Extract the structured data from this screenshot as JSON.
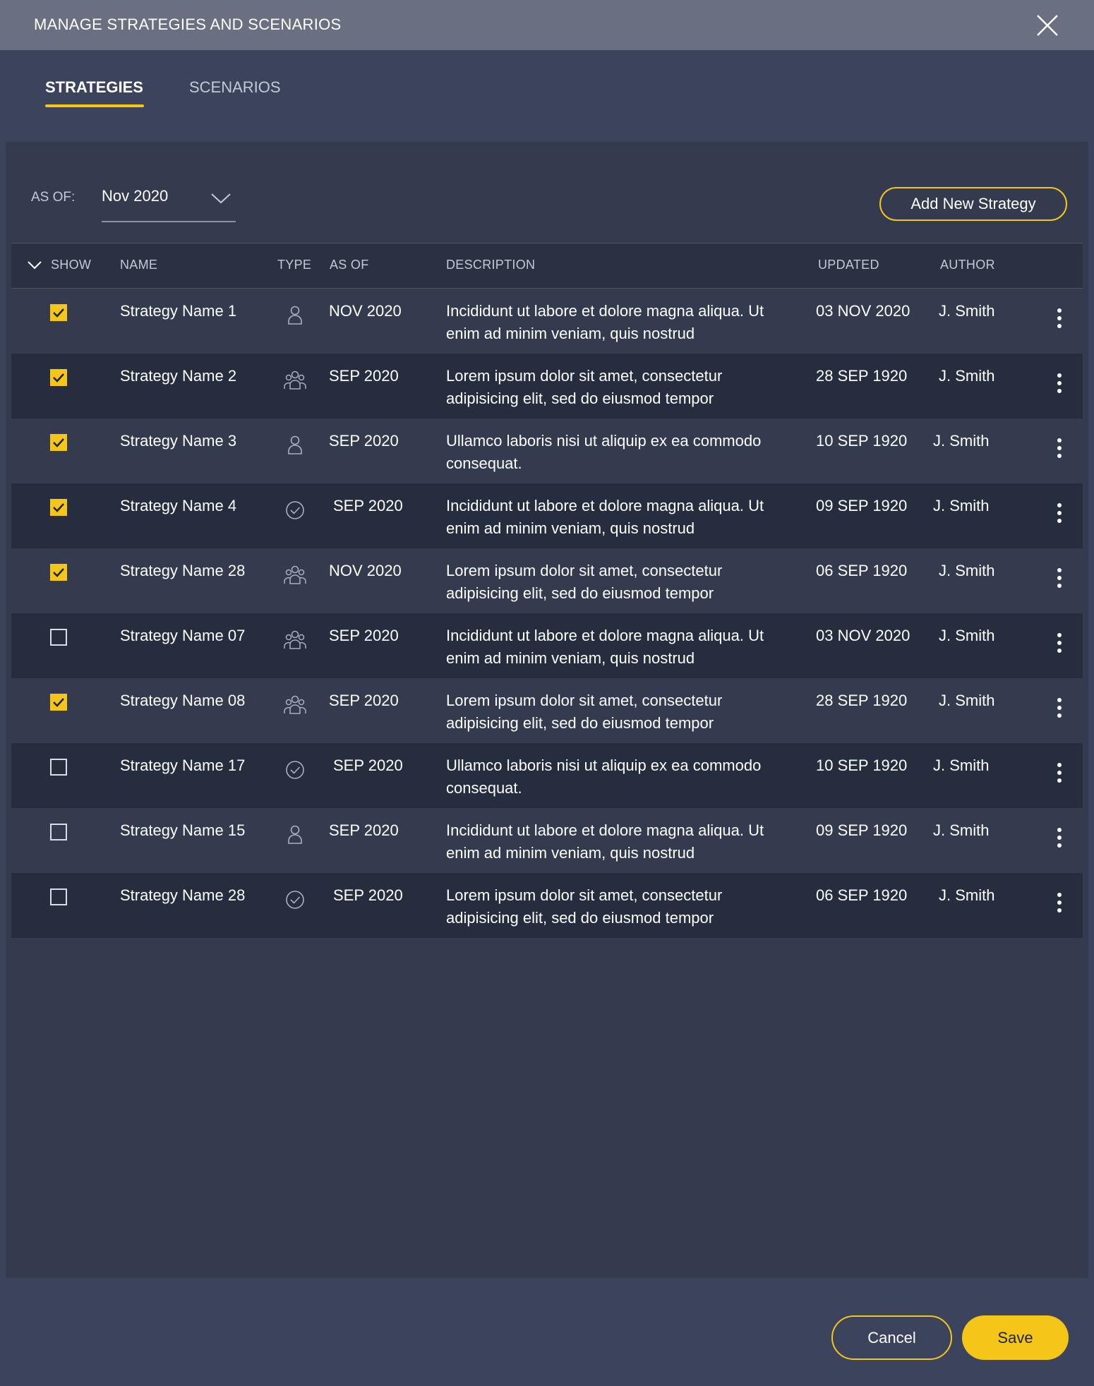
{
  "dialog": {
    "title": "MANAGE STRATEGIES AND SCENARIOS"
  },
  "tabs": [
    {
      "label": "STRATEGIES",
      "active": true
    },
    {
      "label": "SCENARIOS",
      "active": false
    }
  ],
  "filter": {
    "as_of_label": "AS OF:",
    "as_of_value": "Nov 2020"
  },
  "add_button_label": "Add New Strategy",
  "columns": {
    "show": "SHOW",
    "name": "NAME",
    "type": "TYPE",
    "as_of": "AS OF",
    "description": "DESCRIPTION",
    "updated": "UPDATED",
    "author": "AUTHOR"
  },
  "rows": [
    {
      "checked": true,
      "name": "Strategy Name 1",
      "type": "person-icon",
      "as_of": "NOV 2020",
      "description": "Incididunt ut labore et dolore magna aliqua. Ut enim ad minim veniam, quis nostrud",
      "updated": "03 NOV 2020",
      "author": "J. Smith"
    },
    {
      "checked": true,
      "name": "Strategy Name 2",
      "type": "group-icon",
      "as_of": "SEP 2020",
      "description": "Lorem ipsum dolor sit amet, consectetur adipisicing elit, sed do eiusmod tempor",
      "updated": "28 SEP 1920",
      "author": "J. Smith"
    },
    {
      "checked": true,
      "name": "Strategy Name 3",
      "type": "person-icon",
      "as_of": "SEP 2020",
      "description": "Ullamco laboris nisi ut aliquip ex ea commodo consequat.",
      "updated": "10 SEP 1920",
      "author": "J. Smith"
    },
    {
      "checked": true,
      "name": "Strategy Name 4",
      "type": "check-circle-icon",
      "as_of": "SEP 2020",
      "description": "Incididunt ut labore et dolore magna aliqua. Ut enim ad minim veniam, quis nostrud",
      "updated": "09 SEP 1920",
      "author": "J. Smith"
    },
    {
      "checked": true,
      "name": "Strategy Name 28",
      "type": "group-icon",
      "as_of": "NOV 2020",
      "description": "Lorem ipsum dolor sit amet, consectetur adipisicing elit, sed do eiusmod tempor",
      "updated": "06 SEP 1920",
      "author": "J. Smith"
    },
    {
      "checked": false,
      "name": "Strategy Name 07",
      "type": "group-icon",
      "as_of": "SEP 2020",
      "description": "Incididunt ut labore et dolore magna aliqua. Ut enim ad minim veniam, quis nostrud",
      "updated": "03 NOV 2020",
      "author": "J. Smith"
    },
    {
      "checked": true,
      "name": "Strategy Name 08",
      "type": "group-icon",
      "as_of": "SEP 2020",
      "description": "Lorem ipsum dolor sit amet, consectetur adipisicing elit, sed do eiusmod tempor",
      "updated": "28 SEP 1920",
      "author": "J. Smith"
    },
    {
      "checked": false,
      "name": "Strategy Name 17",
      "type": "check-circle-icon",
      "as_of": "SEP 2020",
      "description": "Ullamco laboris nisi ut aliquip ex ea commodo consequat.",
      "updated": "10 SEP 1920",
      "author": "J. Smith"
    },
    {
      "checked": false,
      "name": "Strategy Name 15",
      "type": "person-icon",
      "as_of": "SEP 2020",
      "description": "Incididunt ut labore et dolore magna aliqua. Ut enim ad minim veniam, quis nostrud",
      "updated": "09 SEP 1920",
      "author": "J. Smith"
    },
    {
      "checked": false,
      "name": "Strategy Name 28",
      "type": "check-circle-icon",
      "as_of": "SEP 2020",
      "description": "Lorem ipsum dolor sit amet, consectetur adipisicing elit, sed do eiusmod tempor",
      "updated": "06 SEP 1920",
      "author": "J. Smith"
    }
  ],
  "footer": {
    "cancel_label": "Cancel",
    "save_label": "Save"
  },
  "colors": {
    "accent": "#f5c518",
    "titlebar": "#6a7081",
    "background": "#3b445c"
  }
}
